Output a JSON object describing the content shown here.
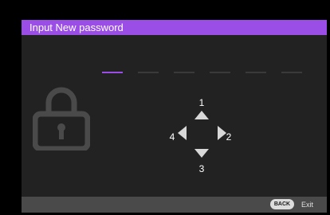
{
  "dialog": {
    "title": "Input New password"
  },
  "password": {
    "total_digits": 6,
    "active_index": 0
  },
  "keypad": {
    "up_label": "1",
    "right_label": "2",
    "down_label": "3",
    "left_label": "4"
  },
  "footer": {
    "back_key_label": "BACK",
    "exit_label": "Exit"
  },
  "colors": {
    "accent": "#9a4ee6",
    "background": "#222222",
    "footer": "#4a4a4a",
    "icon": "#4a4a4a"
  },
  "icons": {
    "lock": "lock-icon",
    "up": "arrow-up-icon",
    "down": "arrow-down-icon",
    "left": "arrow-left-icon",
    "right": "arrow-right-icon"
  }
}
